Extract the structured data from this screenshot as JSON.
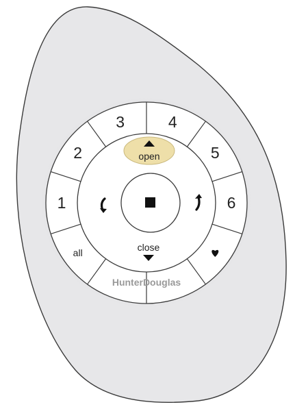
{
  "remote": {
    "colors": {
      "body": "#e7e7e9",
      "outline": "#3a3a3a",
      "face": "#ffffff",
      "open_highlight": "#eedfa9",
      "brand_text": "#9a9a9a"
    },
    "group_buttons": [
      {
        "label": "3",
        "icon": null
      },
      {
        "label": "4",
        "icon": null
      },
      {
        "label": "5",
        "icon": null
      },
      {
        "label": "6",
        "icon": null
      },
      {
        "label": "",
        "icon": "heart-icon"
      },
      {
        "label": "",
        "icon": null
      },
      {
        "label": "",
        "icon": null
      },
      {
        "label": "all",
        "icon": null
      },
      {
        "label": "1",
        "icon": null
      },
      {
        "label": "2",
        "icon": null
      }
    ],
    "open_button": {
      "label": "open",
      "icon": "arrow-up-icon"
    },
    "close_button": {
      "label": "close",
      "icon": "arrow-down-icon"
    },
    "stop_button": {
      "icon": "stop-square-icon"
    },
    "rotate_left_button": {
      "icon": "rotate-left-icon"
    },
    "rotate_right_button": {
      "icon": "rotate-right-icon"
    },
    "brand": "HunterDouglas"
  }
}
